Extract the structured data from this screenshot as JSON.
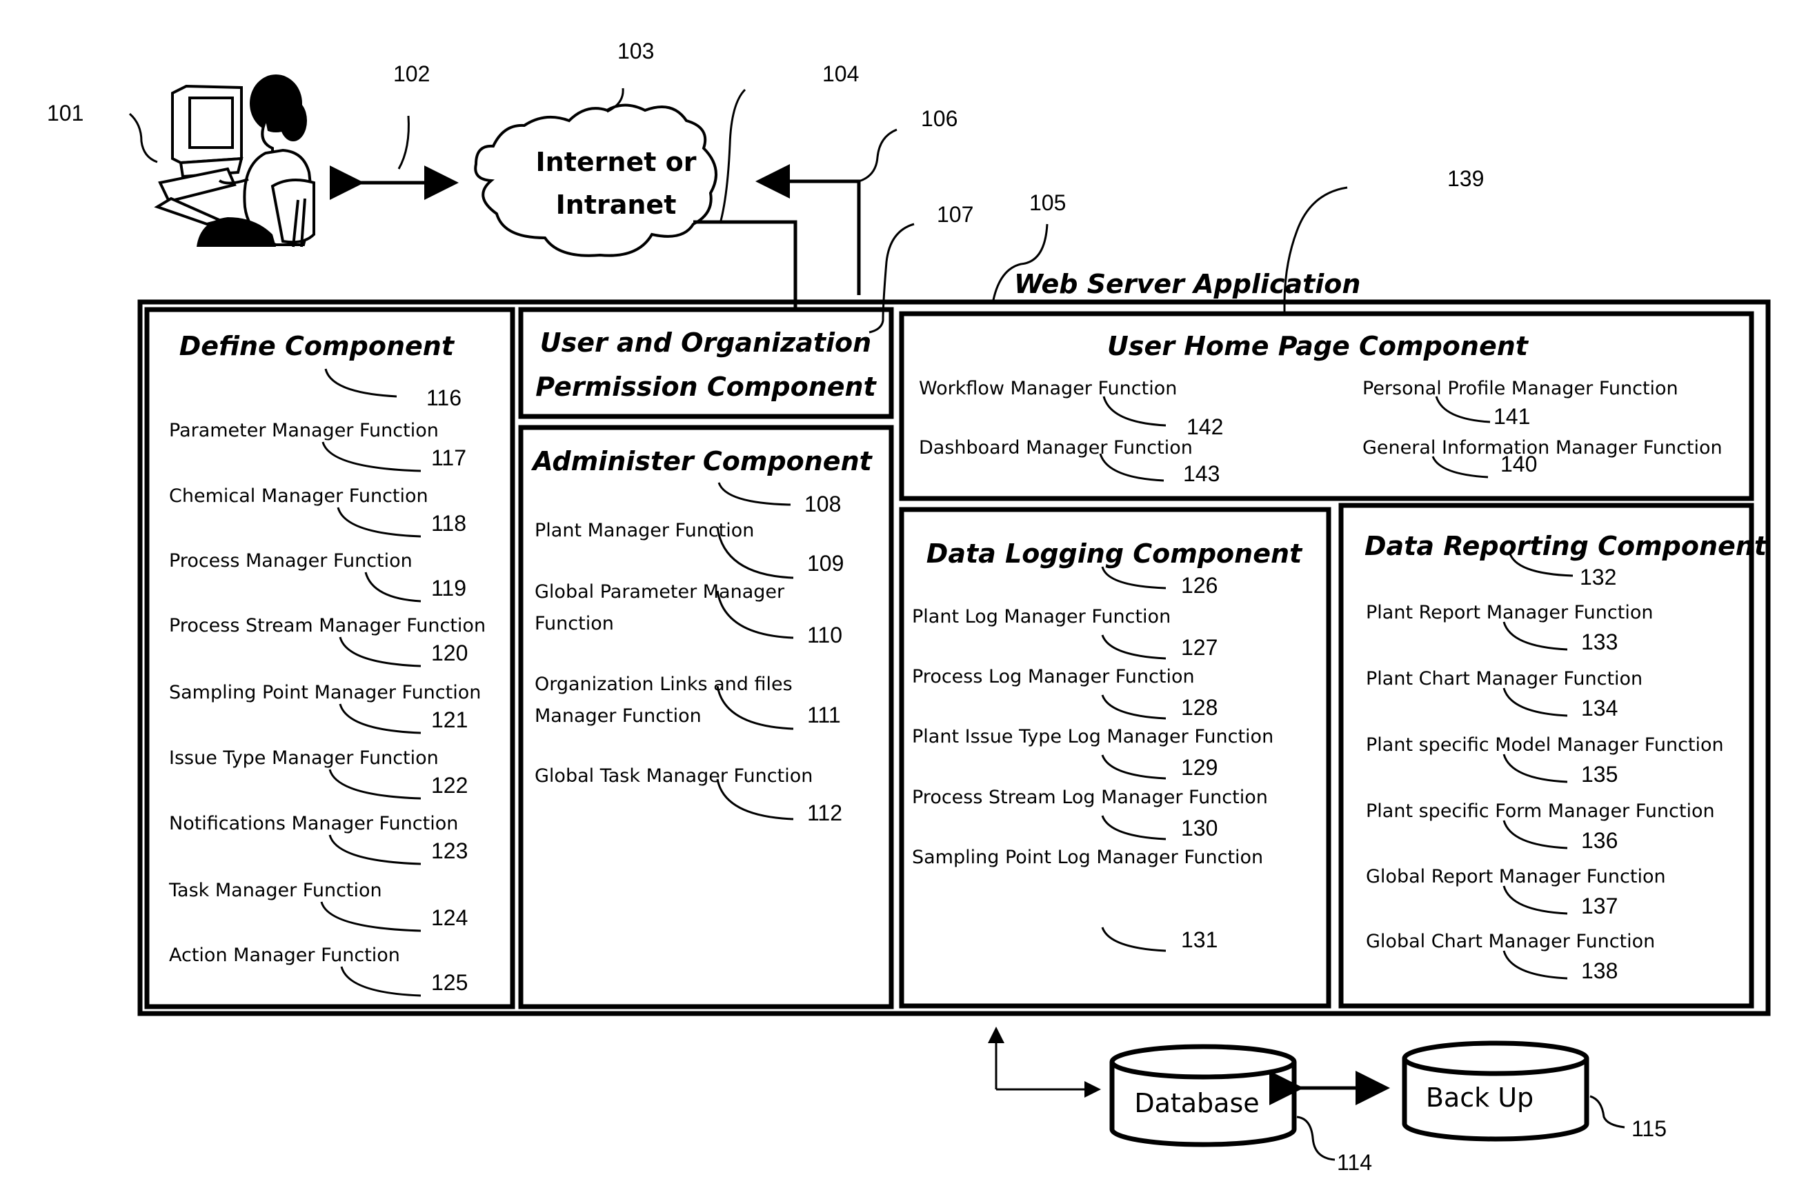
{
  "figure": {
    "user_terminal": {
      "ref": "101",
      "icon": "user-at-computer-icon"
    },
    "user_link": {
      "ref": "102"
    },
    "network": {
      "ref": "103",
      "label_line1": "Internet or",
      "label_line2": "Intranet",
      "icon": "cloud-icon"
    },
    "request_link": {
      "ref": "104"
    },
    "response_link": {
      "ref": "106"
    },
    "web_server": {
      "ref": "105",
      "title": "Web Server Application"
    },
    "permission_component": {
      "ref": "107",
      "title_line1": "User and Organization",
      "title_line2": "Permission Component"
    },
    "database": {
      "ref": "114",
      "label": "Database",
      "icon": "database-cylinder-icon"
    },
    "backup": {
      "ref": "115",
      "label": "Back Up",
      "icon": "database-cylinder-icon"
    },
    "define_component": {
      "title": "Define Component",
      "ref": "116",
      "items": [
        {
          "label": "Parameter Manager Function",
          "ref": "117"
        },
        {
          "label": "Chemical Manager Function",
          "ref": "118"
        },
        {
          "label": "Process Manager Function",
          "ref": "119"
        },
        {
          "label": "Process Stream Manager Function",
          "ref": "120"
        },
        {
          "label": "Sampling Point Manager Function",
          "ref": "121"
        },
        {
          "label": "Issue Type Manager Function",
          "ref": "122"
        },
        {
          "label": "Notifications Manager Function",
          "ref": "123"
        },
        {
          "label": "Task Manager Function",
          "ref": "124"
        },
        {
          "label": "Action Manager Function",
          "ref": "125"
        }
      ]
    },
    "administer_component": {
      "title": "Administer Component",
      "ref": "108",
      "items": [
        {
          "label_line1": "Plant Manager Function",
          "label_line2": "",
          "ref": "109"
        },
        {
          "label_line1": "Global Parameter Manager",
          "label_line2": "Function",
          "ref": "110"
        },
        {
          "label_line1": "Organization Links and files",
          "label_line2": "Manager Function",
          "ref": "111"
        },
        {
          "label_line1": "Global Task Manager Function",
          "label_line2": "",
          "ref": "112"
        }
      ]
    },
    "user_home_component": {
      "title": "User Home Page Component",
      "ref": "139",
      "items": [
        {
          "label": "Workflow Manager Function",
          "ref": "142"
        },
        {
          "label": "Dashboard Manager Function",
          "ref": "143"
        },
        {
          "label": "Personal Profile Manager Function",
          "ref": "141"
        },
        {
          "label": "General Information Manager Function",
          "ref": "140"
        }
      ]
    },
    "data_logging_component": {
      "title": "Data Logging Component",
      "ref": "126",
      "items": [
        {
          "label": "Plant Log Manager Function",
          "ref": "127"
        },
        {
          "label": "Process Log Manager Function",
          "ref": "128"
        },
        {
          "label": "Plant Issue Type Log Manager Function",
          "ref": "129"
        },
        {
          "label": "Process Stream Log Manager Function",
          "ref": "130"
        },
        {
          "label": "Sampling Point Log Manager Function",
          "ref": "131"
        }
      ]
    },
    "data_reporting_component": {
      "title": "Data Reporting Component",
      "ref": "132",
      "items": [
        {
          "label": "Plant Report Manager Function",
          "ref": "133"
        },
        {
          "label": "Plant Chart Manager Function",
          "ref": "134"
        },
        {
          "label": "Plant specific Model Manager Function",
          "ref": "135"
        },
        {
          "label": "Plant specific Form Manager Function",
          "ref": "136"
        },
        {
          "label": "Global Report Manager Function",
          "ref": "137"
        },
        {
          "label": "Global Chart Manager Function",
          "ref": "138"
        }
      ]
    }
  }
}
